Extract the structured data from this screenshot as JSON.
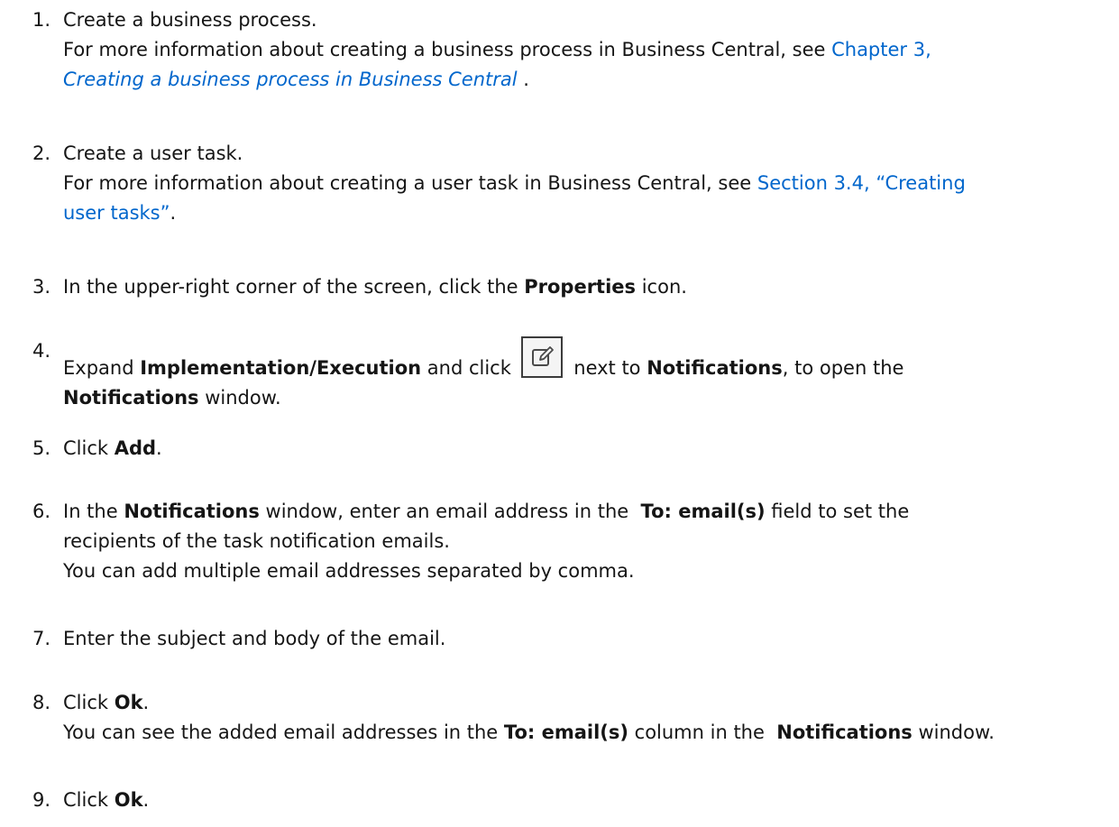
{
  "steps": [
    {
      "number": "1.",
      "lines": [
        {
          "text": "Create a business process."
        },
        {
          "pre": "For more information about creating a business process in Business Central, see ",
          "link": "Chapter 3,"
        },
        {
          "link_italic": "Creating a business process in Business Central",
          "post": " ."
        }
      ]
    },
    {
      "number": "2.",
      "lines": [
        {
          "text": "Create a user task."
        },
        {
          "pre": "For more information about creating a user task in Business Central, see ",
          "link": "Section 3.4, “Creating"
        },
        {
          "link": "user tasks”",
          "post": "."
        }
      ]
    },
    {
      "number": "3.",
      "pre": "In the upper-right corner of the screen, click the ",
      "bold": "Properties",
      "post": " icon."
    },
    {
      "number": "4.",
      "line1": {
        "pre": "Expand ",
        "bold1": "Implementation/Execution",
        "mid1": " and click ",
        "mid2": " next to ",
        "bold2": "Notifications",
        "post": ", to open the"
      },
      "line2": {
        "bold": "Notifications",
        "post": " window."
      },
      "icon": "edit-icon"
    },
    {
      "number": "5.",
      "pre": "Click ",
      "bold": "Add",
      "post": "."
    },
    {
      "number": "6.",
      "line1": {
        "pre": "In the ",
        "bold1": "Notifications",
        "mid": " window, enter an email address in the  ",
        "bold2": "To: email(s)",
        "post": " field to set the"
      },
      "line2": "recipients of the task notification emails.",
      "line3": "You can add multiple email addresses separated by comma."
    },
    {
      "number": "7.",
      "text": "Enter the subject and body of the email."
    },
    {
      "number": "8.",
      "line1": {
        "pre": "Click ",
        "bold": "Ok",
        "post": "."
      },
      "line2": {
        "pre": "You can see the added email addresses in the ",
        "bold1": "To: email(s)",
        "mid": " column in the  ",
        "bold2": "Notifications",
        "post": " window."
      }
    },
    {
      "number": "9.",
      "pre": "Click ",
      "bold": "Ok",
      "post": "."
    }
  ],
  "colors": {
    "text": "#151515",
    "link": "#0066cc"
  }
}
